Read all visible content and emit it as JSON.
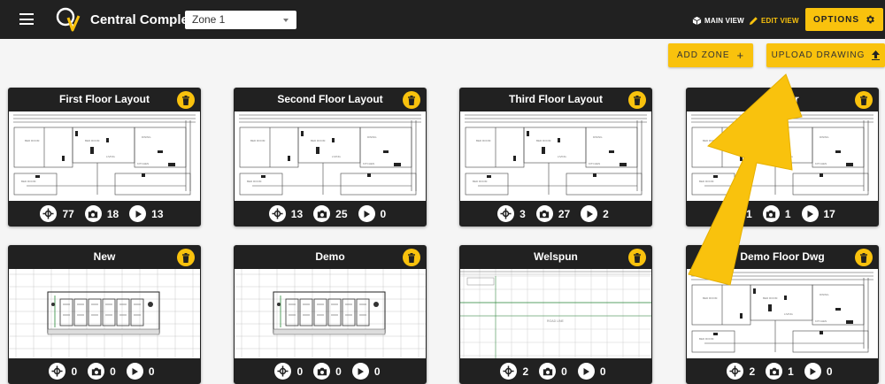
{
  "app": {
    "title": "Central Complex"
  },
  "zone_select": {
    "value": "Zone 1"
  },
  "nav": {
    "main_view": "MAIN VIEW",
    "edit_view": "EDIT VIEW",
    "options": "OPTIONS"
  },
  "actions": {
    "add_zone": "ADD ZONE",
    "upload": "UPLOAD DRAWING"
  },
  "colors": {
    "accent": "#f9c20d",
    "bar": "#212121",
    "background": "#f5f5f5"
  },
  "cards": [
    {
      "title": "First Floor Layout",
      "plan": "floor",
      "stats": [
        "77",
        "18",
        "13"
      ]
    },
    {
      "title": "Second Floor Layout",
      "plan": "floor",
      "stats": [
        "13",
        "25",
        "0"
      ]
    },
    {
      "title": "Third Floor Layout",
      "plan": "floor",
      "stats": [
        "3",
        "27",
        "2"
      ]
    },
    {
      "title": "p floor",
      "plan": "floor",
      "stats": [
        "1",
        "1",
        "17"
      ]
    },
    {
      "title": "New",
      "plan": "building",
      "stats": [
        "0",
        "0",
        "0"
      ]
    },
    {
      "title": "Demo",
      "plan": "building",
      "stats": [
        "0",
        "0",
        "0"
      ]
    },
    {
      "title": "Welspun",
      "plan": "grid",
      "stats": [
        "2",
        "0",
        "0"
      ]
    },
    {
      "title": "Demo Floor Dwg",
      "plan": "floor",
      "stats": [
        "2",
        "1",
        "0"
      ]
    }
  ],
  "icons": {
    "menu": "hamburger-menu-icon",
    "main_view": "cube-icon",
    "edit_view": "pencil-icon",
    "options": "gear-icon",
    "add_zone": "plus-icon",
    "upload": "upload-arrow-icon",
    "delete": "trash-icon",
    "stat_1": "compass-pin-icon",
    "stat_2": "camera-icon",
    "stat_3": "play-icon"
  }
}
